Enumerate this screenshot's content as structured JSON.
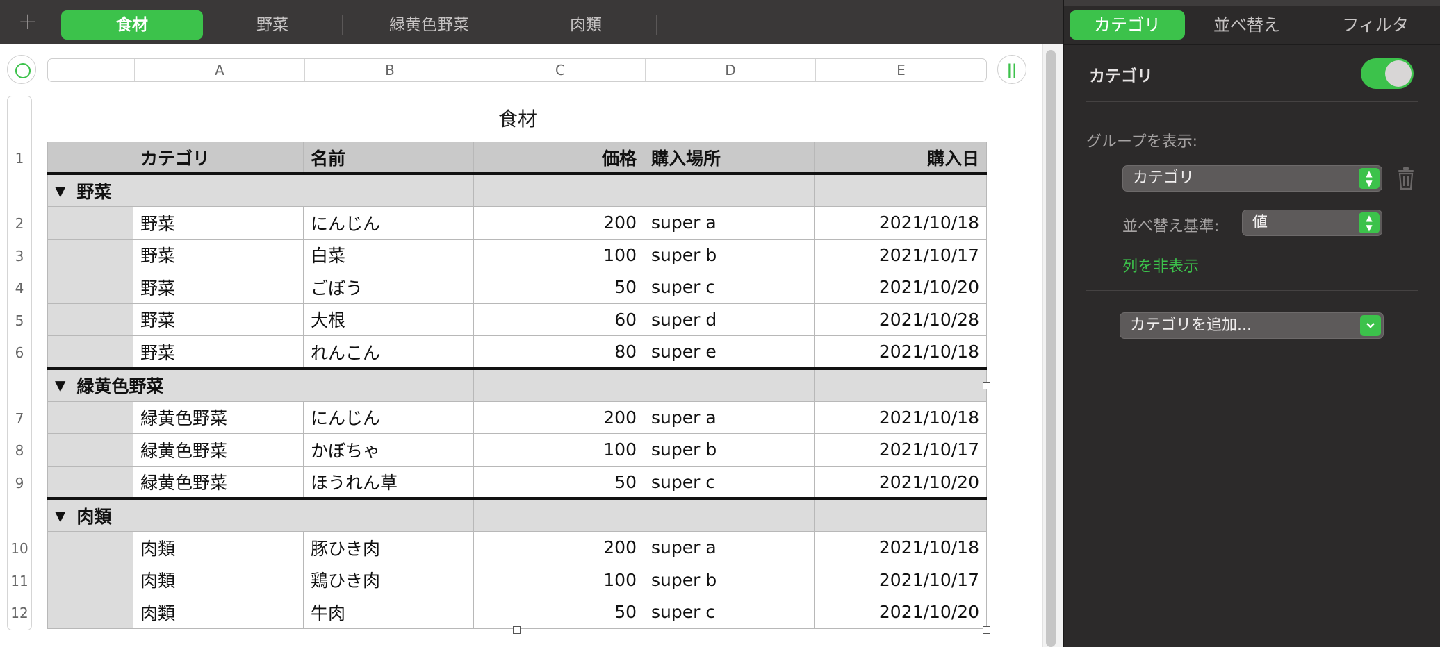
{
  "sheet_tabs": {
    "add_label": "+",
    "tabs": [
      {
        "label": "食材",
        "active": true
      },
      {
        "label": "野菜",
        "active": false
      },
      {
        "label": "緑黄色野菜",
        "active": false
      },
      {
        "label": "肉類",
        "active": false
      }
    ]
  },
  "inspector": {
    "tabs": [
      {
        "label": "カテゴリ",
        "active": true
      },
      {
        "label": "並べ替え",
        "active": false
      },
      {
        "label": "フィルタ",
        "active": false
      }
    ],
    "heading": "カテゴリ",
    "toggle_on": true,
    "group_label": "グループを表示:",
    "group_popup": "カテゴリ",
    "sort_label": "並べ替え基準:",
    "sort_popup": "値",
    "hide_column_link": "列を非表示",
    "add_category_popup": "カテゴリを追加..."
  },
  "spreadsheet": {
    "column_headers": [
      "A",
      "B",
      "C",
      "D",
      "E"
    ],
    "table_title": "食材",
    "header_row": {
      "num": "1",
      "cells": [
        "",
        "カテゴリ",
        "名前",
        "価格",
        "購入場所",
        "購入日"
      ]
    },
    "groups": [
      {
        "name": "野菜",
        "rows": [
          {
            "num": "2",
            "cells": [
              "野菜",
              "にんじん",
              "200",
              "super a",
              "2021/10/18"
            ]
          },
          {
            "num": "3",
            "cells": [
              "野菜",
              "白菜",
              "100",
              "super b",
              "2021/10/17"
            ]
          },
          {
            "num": "4",
            "cells": [
              "野菜",
              "ごぼう",
              "50",
              "super c",
              "2021/10/20"
            ]
          },
          {
            "num": "5",
            "cells": [
              "野菜",
              "大根",
              "60",
              "super d",
              "2021/10/28"
            ]
          },
          {
            "num": "6",
            "cells": [
              "野菜",
              "れんこん",
              "80",
              "super e",
              "2021/10/18"
            ]
          }
        ]
      },
      {
        "name": "緑黄色野菜",
        "rows": [
          {
            "num": "7",
            "cells": [
              "緑黄色野菜",
              "にんじん",
              "200",
              "super a",
              "2021/10/18"
            ]
          },
          {
            "num": "8",
            "cells": [
              "緑黄色野菜",
              "かぼちゃ",
              "100",
              "super b",
              "2021/10/17"
            ]
          },
          {
            "num": "9",
            "cells": [
              "緑黄色野菜",
              "ほうれん草",
              "50",
              "super c",
              "2021/10/20"
            ]
          }
        ]
      },
      {
        "name": "肉類",
        "rows": [
          {
            "num": "10",
            "cells": [
              "肉類",
              "豚ひき肉",
              "200",
              "super a",
              "2021/10/18"
            ]
          },
          {
            "num": "11",
            "cells": [
              "肉類",
              "鶏ひき肉",
              "100",
              "super b",
              "2021/10/17"
            ]
          },
          {
            "num": "12",
            "cells": [
              "肉類",
              "牛肉",
              "50",
              "super c",
              "2021/10/20"
            ]
          }
        ]
      }
    ]
  },
  "colors": {
    "accent": "#3cc24b",
    "panel_bg": "#2c2a2a",
    "tabbar_bg": "#3a3838"
  }
}
